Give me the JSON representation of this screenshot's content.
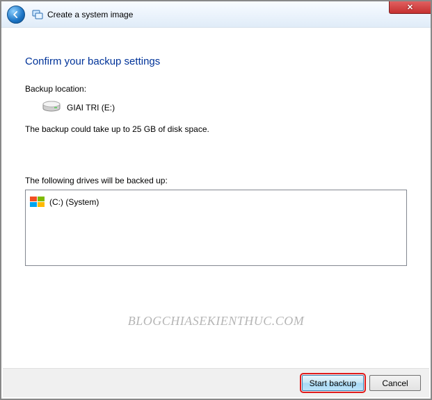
{
  "window": {
    "title": "Create a system image",
    "close_symbol": "✕"
  },
  "page": {
    "heading": "Confirm your backup settings",
    "backup_location_label": "Backup location:",
    "backup_drive": "GIAI TRI (E:)",
    "size_note": "The backup could take up to 25 GB of disk space.",
    "drives_list_label": "The following drives will be backed up:",
    "drives": [
      {
        "label": "(C:) (System)"
      }
    ]
  },
  "buttons": {
    "start": "Start backup",
    "cancel": "Cancel"
  },
  "watermark": "BLOGCHIASEKIENTHUC.COM"
}
